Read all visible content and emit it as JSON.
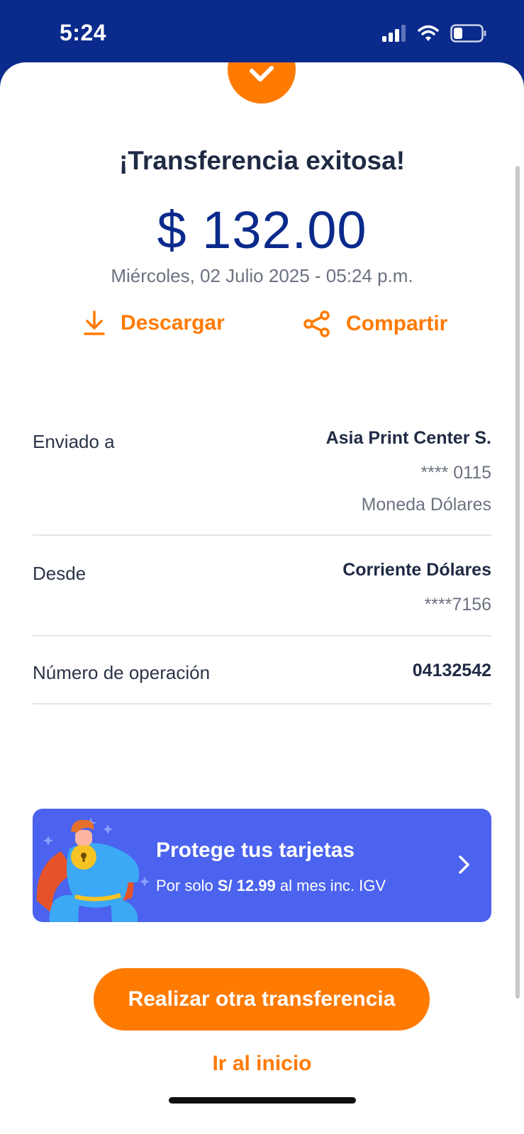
{
  "status_bar": {
    "time": "5:24"
  },
  "receipt": {
    "title": "¡Transferencia exitosa!",
    "amount": "$ 132.00",
    "datetime": "Miércoles, 02 Julio 2025 - 05:24 p.m."
  },
  "actions": {
    "download": "Descargar",
    "share": "Compartir"
  },
  "details": {
    "sent_to": {
      "label": "Enviado a",
      "name": "Asia Print Center S.",
      "account": "**** 0115",
      "currency": "Moneda Dólares"
    },
    "from": {
      "label": "Desde",
      "account_name": "Corriente Dólares",
      "account": "****7156"
    },
    "operation": {
      "label": "Número de operación",
      "number": "04132542"
    }
  },
  "promo": {
    "title": "Protege tus tarjetas",
    "sub_prefix": "Por solo ",
    "price": "S/ 12.99",
    "sub_suffix": " al mes inc. IGV"
  },
  "buttons": {
    "primary": "Realizar otra transferencia",
    "home": "Ir al inicio"
  },
  "colors": {
    "brand_blue": "#0a2a8c",
    "accent_orange": "#ff7a00",
    "promo_blue": "#4b63ee"
  }
}
